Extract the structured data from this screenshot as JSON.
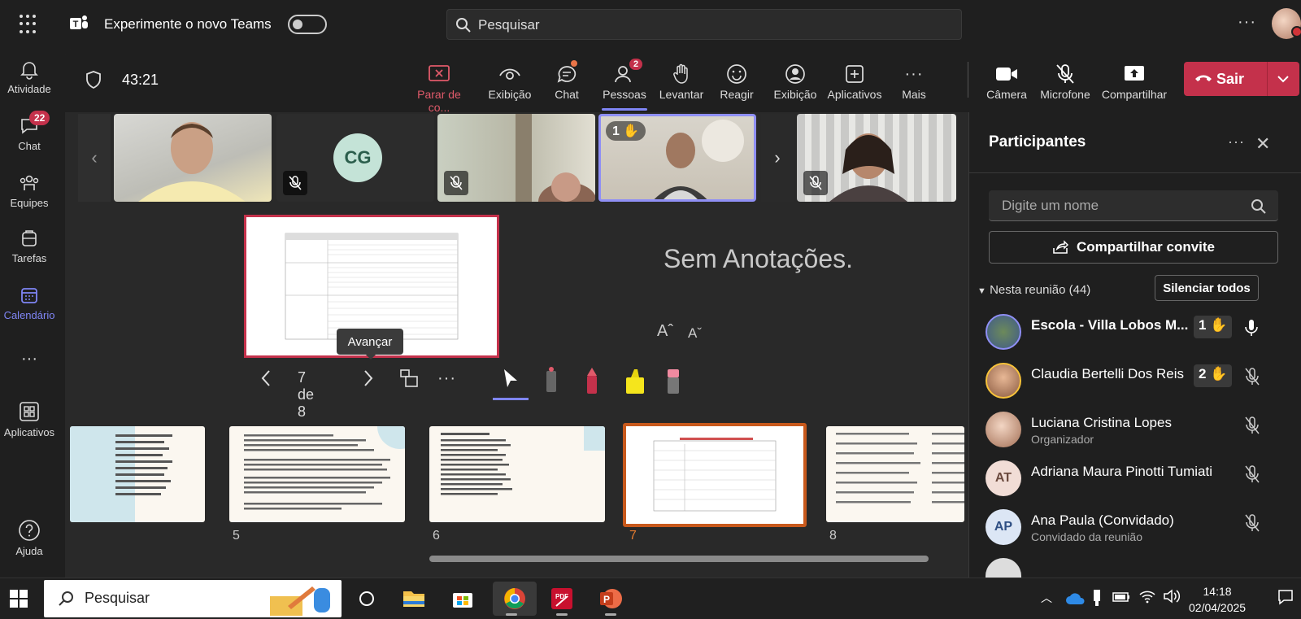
{
  "topbar": {
    "try_new_teams": "Experimente o novo Teams",
    "search_placeholder": "Pesquisar",
    "more": "···"
  },
  "rail": [
    {
      "label": "Atividade",
      "icon": "bell-icon"
    },
    {
      "label": "Chat",
      "icon": "chat-icon",
      "badge": "22"
    },
    {
      "label": "Equipes",
      "icon": "teams-icon"
    },
    {
      "label": "Tarefas",
      "icon": "tasks-icon"
    },
    {
      "label": "Calendário",
      "icon": "calendar-icon",
      "active": true
    },
    {
      "label": "···",
      "icon": "more-icon"
    },
    {
      "label": "Aplicativos",
      "icon": "apps-icon"
    },
    {
      "label": "Ajuda",
      "icon": "help-icon"
    }
  ],
  "toolbar": {
    "timer": "43:21",
    "stop_sharing": "Parar de co...",
    "view1": "Exibição",
    "chat": "Chat",
    "people": "Pessoas",
    "people_badge": "2",
    "raise": "Levantar",
    "react": "Reagir",
    "view2": "Exibição",
    "apps": "Aplicativos",
    "more": "Mais",
    "camera": "Câmera",
    "mic": "Microfone",
    "share": "Compartilhar",
    "leave": "Sair"
  },
  "video_strip": {
    "cg_initials": "CG",
    "raised_hand_count": "1"
  },
  "presenter": {
    "tooltip": "Avançar",
    "page_counter": "7 de 8",
    "no_notes": "Sem Anotações.",
    "font_up": "Aˆ",
    "font_down": "Aˇ"
  },
  "thumbnails": [
    {
      "num": ""
    },
    {
      "num": "5"
    },
    {
      "num": "6"
    },
    {
      "num": "7",
      "selected": true
    },
    {
      "num": "8"
    }
  ],
  "panel": {
    "title": "Participantes",
    "search_placeholder": "Digite um nome",
    "share_invite": "Compartilhar convite",
    "section": "Nesta reunião (44)",
    "mute_all": "Silenciar todos",
    "people": [
      {
        "name": "Escola - Villa Lobos M...",
        "hand": "1",
        "bold": true
      },
      {
        "name": "Claudia Bertelli Dos Reis",
        "hand": "2"
      },
      {
        "name": "Luciana Cristina Lopes",
        "sub": "Organizador"
      },
      {
        "name": "Adriana Maura Pinotti Tumiati",
        "initials": "AT"
      },
      {
        "name": "Ana Paula (Convidado)",
        "sub": "Convidado da reunião",
        "initials": "AP"
      }
    ]
  },
  "taskbar": {
    "search": "Pesquisar",
    "time": "14:18",
    "date": "02/04/2025"
  }
}
